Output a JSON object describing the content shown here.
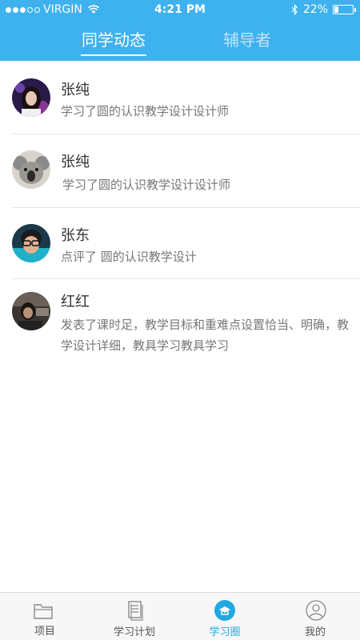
{
  "status_bar": {
    "carrier": "VIRGIN",
    "time": "4:21 PM",
    "battery": "22%",
    "battery_level": 0.22
  },
  "header": {
    "tabs": [
      {
        "label": "同学动态",
        "active": true
      },
      {
        "label": "辅导者",
        "active": false
      }
    ],
    "color": "#3eb1ef"
  },
  "feed": [
    {
      "name": "张纯",
      "action": "学习了圆的认识教学设计设计师",
      "avatar": "avatar-girl"
    },
    {
      "name": "张纯",
      "action": "学习了圆的认识教学设计设计师",
      "avatar": "avatar-koala"
    },
    {
      "name": "张东",
      "action": "点评了  圆的认识教学设计",
      "avatar": "avatar-glasses"
    },
    {
      "name": "红红",
      "action": "发表了课时足，教学目标和重难点设置恰当、明确，教学设计详细，教具学习教具学习",
      "avatar": "avatar-dark"
    }
  ],
  "tabbar": {
    "items": [
      {
        "label": "项目",
        "icon": "folder-icon",
        "active": false
      },
      {
        "label": "学习计划",
        "icon": "document-icon",
        "active": false
      },
      {
        "label": "学习圈",
        "icon": "learning-circle-icon",
        "active": true
      },
      {
        "label": "我的",
        "icon": "user-icon",
        "active": false
      }
    ],
    "active_color": "#22a8e0"
  }
}
